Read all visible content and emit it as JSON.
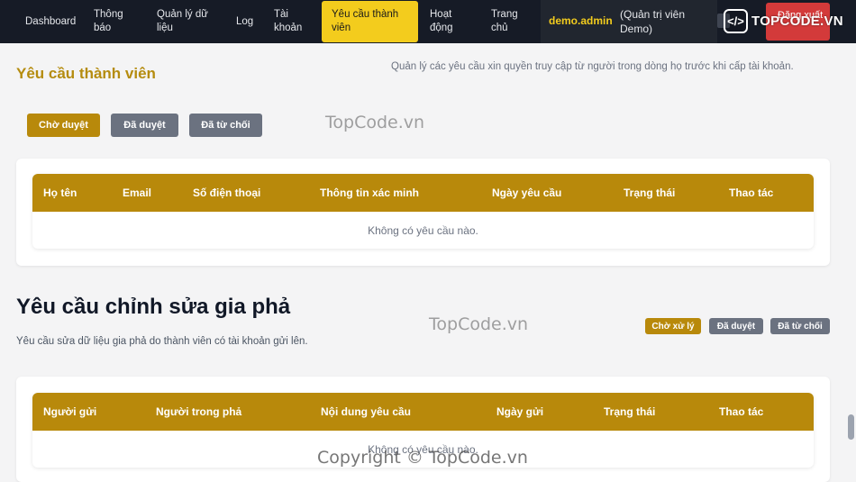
{
  "nav": {
    "items": [
      {
        "label": "Dashboard"
      },
      {
        "label": "Thông báo"
      },
      {
        "label": "Quản lý dữ liệu"
      },
      {
        "label": "Log"
      },
      {
        "label": "Tài khoản"
      },
      {
        "label": "Yêu cầu thành viên"
      },
      {
        "label": "Hoạt động"
      },
      {
        "label": "Trang chủ"
      }
    ],
    "user_name": "demo.admin",
    "user_role": "(Quản trị viên Demo)",
    "logout_label": "Đăng xuất"
  },
  "member_requests": {
    "title": "Yêu cầu thành viên",
    "description": "Quản lý các yêu cầu xin quyền truy cập từ người trong dòng họ trước khi cấp tài khoản.",
    "tabs": [
      {
        "label": "Chờ duyệt",
        "active": true
      },
      {
        "label": "Đã duyệt",
        "active": false
      },
      {
        "label": "Đã từ chối",
        "active": false
      }
    ],
    "columns": [
      "Họ tên",
      "Email",
      "Số điện thoại",
      "Thông tin xác minh",
      "Ngày yêu cầu",
      "Trạng thái",
      "Thao tác"
    ],
    "empty_text": "Không có yêu cầu nào."
  },
  "edit_requests": {
    "title": "Yêu cầu chỉnh sửa gia phả",
    "description": "Yêu cầu sửa dữ liệu gia phả do thành viên có tài khoản gửi lên.",
    "tabs": [
      {
        "label": "Chờ xử lý",
        "active": true
      },
      {
        "label": "Đã duyệt",
        "active": false
      },
      {
        "label": "Đã từ chối",
        "active": false
      }
    ],
    "columns": [
      "Người gửi",
      "Người trong phả",
      "Nội dung yêu cầu",
      "Ngày gửi",
      "Trạng thái",
      "Thao tác"
    ],
    "empty_text": "Không có yêu cầu nào."
  },
  "watermarks": {
    "logo_text": "TOPCODE.VN",
    "text_1": "TopCode.vn",
    "text_2": "TopCode.vn",
    "copyright": "Copyright © TopCode.vn"
  },
  "colors": {
    "nav_bg": "#161b26",
    "accent_yellow": "#f3cc1d",
    "gold": "#b8890b",
    "gray_button": "#6b7280",
    "danger": "#d33a3a"
  }
}
